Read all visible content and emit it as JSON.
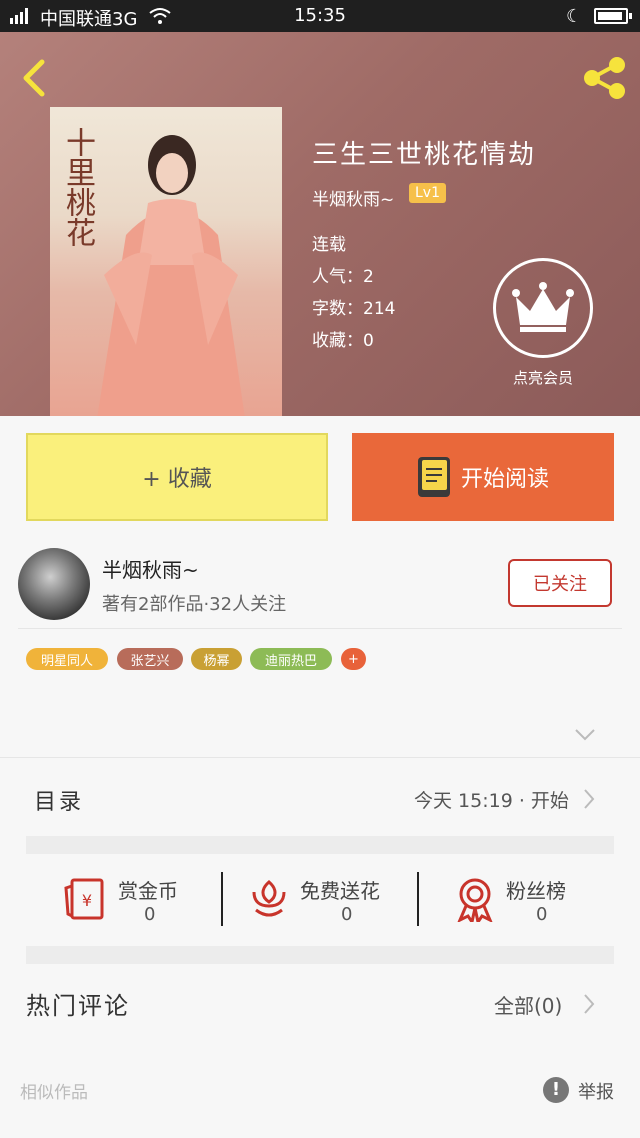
{
  "status_bar": {
    "carrier": "中国联通3G",
    "time": "15:35"
  },
  "book": {
    "title": "三生三世桃花情劫",
    "author": "半烟秋雨~",
    "level": "Lv1",
    "status": "连载",
    "popularity": "人气：2",
    "word_count": "字数：214",
    "favorites": "收藏：0",
    "vip_label": "点亮会员"
  },
  "actions": {
    "collect_label": "+ 收藏",
    "read_label": "开始阅读"
  },
  "author": {
    "name": "半烟秋雨~",
    "summary": "著有2部作品·32人关注",
    "follow_label": "已关注"
  },
  "tags": [
    {
      "label": "明星同人",
      "color": "#f0b33a"
    },
    {
      "label": "张艺兴",
      "color": "#b86c5a"
    },
    {
      "label": "杨幂",
      "color": "#c9a034"
    },
    {
      "label": "迪丽热巴",
      "color": "#8dbb56"
    },
    {
      "label": "+",
      "color": "#e8623a"
    }
  ],
  "catalog": {
    "label": "目录",
    "meta": "今天 15:19 · 开始"
  },
  "stats": [
    {
      "name": "赏金币",
      "value": "0"
    },
    {
      "name": "免费送花",
      "value": "0"
    },
    {
      "name": "粉丝榜",
      "value": "0"
    }
  ],
  "comments": {
    "label": "热门评论",
    "all_label": "全部(0)"
  },
  "footer": {
    "similar_label": "相似作品",
    "report_label": "举报",
    "report_icon": "!"
  },
  "colors": {
    "accent_orange": "#e9683a",
    "collect_yellow": "#faf07c",
    "follow_red": "#c3382f"
  }
}
